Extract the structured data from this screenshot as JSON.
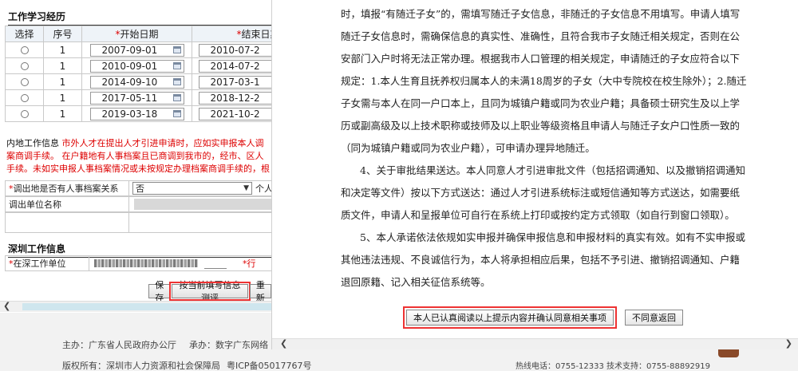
{
  "work_history": {
    "title": "工作学习经历",
    "headers": {
      "select": "选择",
      "seq": "序号",
      "start": "开始日期",
      "end": "结束日期",
      "req_mark": "*"
    },
    "rows": [
      {
        "seq": "1",
        "start": "2007-09-01",
        "end": "2010-07-2"
      },
      {
        "seq": "1",
        "start": "2010-09-01",
        "end": "2014-07-2"
      },
      {
        "seq": "1",
        "start": "2014-09-10",
        "end": "2017-03-1"
      },
      {
        "seq": "1",
        "start": "2017-05-11",
        "end": "2018-12-2"
      },
      {
        "seq": "1",
        "start": "2019-03-18",
        "end": "2021-10-2"
      }
    ]
  },
  "inland": {
    "label": "内地工作信息",
    "notice_1": "市外人才在提出人才引进申请时，应如实申报本人调",
    "notice_2": "案商调手续。 在户籍地有人事档案且已商调到我市的，经市、区人",
    "notice_3": "手续。未如实申报人事档案情况或未按规定办理档案商调手续的，",
    "notice_3_tail": "根",
    "archive_label": "调出地是否有人事档案关系",
    "archive_value": "否",
    "archive_after": "个人",
    "unit_label": "调出单位名称",
    "req_mark": "*"
  },
  "shenzhen": {
    "title": "深圳工作信息",
    "unit_label": "在深工作单位",
    "tail_label": "*行",
    "req_mark": "*"
  },
  "buttons": {
    "save": "保存",
    "evaluate": "按当前填写信息测评",
    "reset": "重新",
    "agree": "本人已认真阅读以上提示内容并确认同意相关事项",
    "disagree": "不同意返回"
  },
  "modal": {
    "p1": "时，填报“有随迁子女”的，需填写随迁子女信息，非随迁的子女信息不用填写。申请人填写随迁子女信息时，需确保信息的真实性、准确性，且符合我市子女随迁相关规定，否则在公安部门入户时将无法正常办理。根据我市人口管理的相关规定，申请随迁的子女应符合以下规定：1.本人生育且抚养权归属本人的未满18周岁的子女（大中专院校在校生除外）；2.随迁子女需与本人在同一户口本上，且同为城镇户籍或同为农业户籍；具备硕士研究生及以上学历或副高级及以上技术职称或技师及以上职业等级资格且申请人与随迁子女户口性质一致的（同为城镇户籍或同为农业户籍），可申请办理异地随迁。",
    "p2": "4、关于审批结果送达。本人同意人才引进审批文件（包括招调通知、以及撤销招调通知和决定等文件）按以下方式送达：通过人才引进系统标注或短信通知等方式送达，如需要纸质文件，申请人和呈报单位可自行在系统上打印或按约定方式领取（如自行到窗口领取）。",
    "p3": "5、本人承诺依法依规如实申报并确保申报信息和申报材料的真实有效。如有不实申报或其他违法违规、不良诚信行为，本人将承担相应后果，包括不予引进、撤销招调通知、户籍退回原籍、记入相关征信系统等。"
  },
  "footer": {
    "host": "主办：广东省人民政府办公厅",
    "organizer": "承办：数字广东网络",
    "copyright": "版权所有：深圳市人力资源和社会保障局",
    "icp": "粤ICP备05017767号",
    "contact": "热线电话：0755-12333 技术支持：0755-88892919"
  },
  "colors": {
    "required": "#dd0000",
    "highlight": "#e33333",
    "scroll_thumb": "#cfe6ee"
  },
  "icons": {
    "calendar": "calendar-icon",
    "dropdown": "chevron-down-icon",
    "scroll_left": "scroll-left-arrow-icon",
    "scroll_right": "scroll-right-arrow-icon"
  }
}
